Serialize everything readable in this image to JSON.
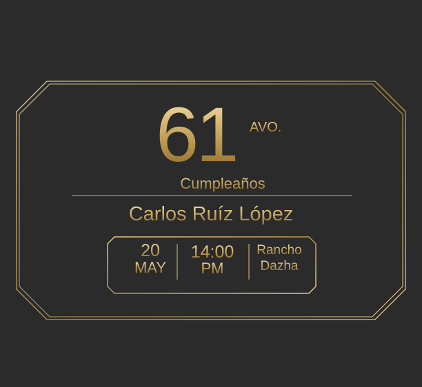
{
  "invitation": {
    "age_number": "61",
    "age_suffix": "AVO.",
    "occasion": "Cumpleaños",
    "honoree": "Carlos Ruíz López",
    "date": {
      "day": "20",
      "month": "MAY"
    },
    "time": {
      "hour": "14:00",
      "period": "PM"
    },
    "venue": {
      "line1": "Rancho",
      "line2": "Dazha"
    }
  },
  "colors": {
    "background": "#2b2b2b",
    "gold_light": "#f3e3ae",
    "gold_mid": "#c9a960",
    "gold_dark": "#8d6b30"
  }
}
